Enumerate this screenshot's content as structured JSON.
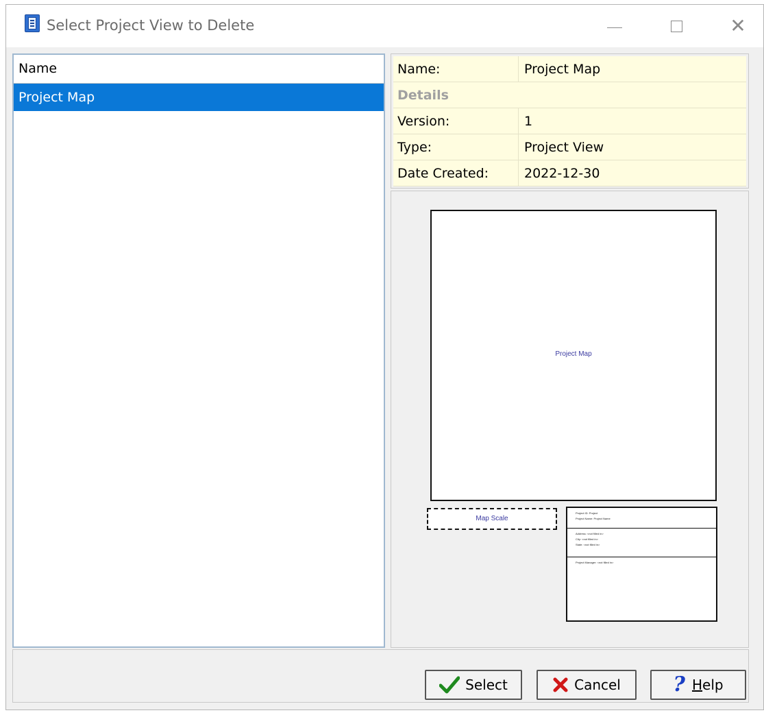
{
  "window": {
    "title": "Select Project View to Delete"
  },
  "list": {
    "header": "Name",
    "items": [
      {
        "label": "Project Map",
        "selected": true
      }
    ]
  },
  "details": {
    "name_label": "Name:",
    "name_value": "Project Map",
    "section_label": "Details",
    "version_label": "Version:",
    "version_value": "1",
    "type_label": "Type:",
    "type_value": "Project View",
    "date_label": "Date Created:",
    "date_value": "2022-12-30"
  },
  "preview": {
    "map_title": "Project Map",
    "map_scale_label": "Map Scale",
    "title_block": {
      "section1": [
        "Project ID: Project",
        "Project Name: Project Name"
      ],
      "section2": [
        "Address: <not filled in>",
        "City: <not filled in>",
        "State: <not filled in>"
      ],
      "section3": [
        "Project Manager: <not filled in>"
      ]
    }
  },
  "buttons": {
    "select": "Select",
    "cancel": "Cancel",
    "help_first": "H",
    "help_rest": "elp"
  },
  "colors": {
    "selection": "#0a78d7",
    "details_bg": "#fffde0",
    "accent_blue": "#1a3fc4"
  }
}
